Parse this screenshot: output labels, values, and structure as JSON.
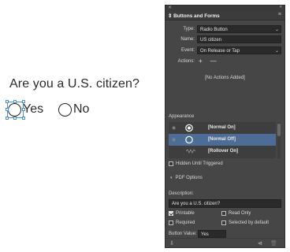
{
  "page": {
    "question": "Are you a U.S. citizen?",
    "options": [
      {
        "label": "Yes",
        "selected_in_layout": true
      },
      {
        "label": "No",
        "selected_in_layout": false
      }
    ]
  },
  "panel": {
    "title": "Buttons and Forms",
    "icons": {
      "close": "close-icon",
      "collapse": "double-chevron-icon",
      "menu": "hamburger-menu-icon"
    },
    "type": {
      "label": "Type:",
      "value": "Radio Button"
    },
    "name": {
      "label": "Name:",
      "value": "US citizen"
    },
    "event": {
      "label": "Event:",
      "value": "On Release or Tap"
    },
    "actions": {
      "label": "Actions:",
      "add": "+",
      "remove": "—",
      "empty_text": "[No Actions Added]"
    },
    "appearance": {
      "label": "Appearance",
      "items": [
        {
          "name": "[Normal On]",
          "selected": false
        },
        {
          "name": "[Normal Off]",
          "selected": true
        },
        {
          "name": "[Rollover On]",
          "selected": false
        }
      ]
    },
    "hidden_until_triggered": {
      "label": "Hidden Until Triggered",
      "checked": false
    },
    "pdf_options": {
      "label": "PDF Options"
    },
    "description": {
      "label": "Description:",
      "value": "Are you a U.S. citizen?"
    },
    "printable": {
      "label": "Printable",
      "checked": true
    },
    "read_only": {
      "label": "Read Only",
      "checked": false
    },
    "required": {
      "label": "Required",
      "checked": false
    },
    "selected_by_default": {
      "label": "Selected by default",
      "checked": false
    },
    "button_value": {
      "label": "Button Value:",
      "value": "Yes"
    },
    "colors": {
      "panel_bg": "#464646",
      "field_bg": "#2a2a2a",
      "selection": "#4d6d96"
    }
  }
}
